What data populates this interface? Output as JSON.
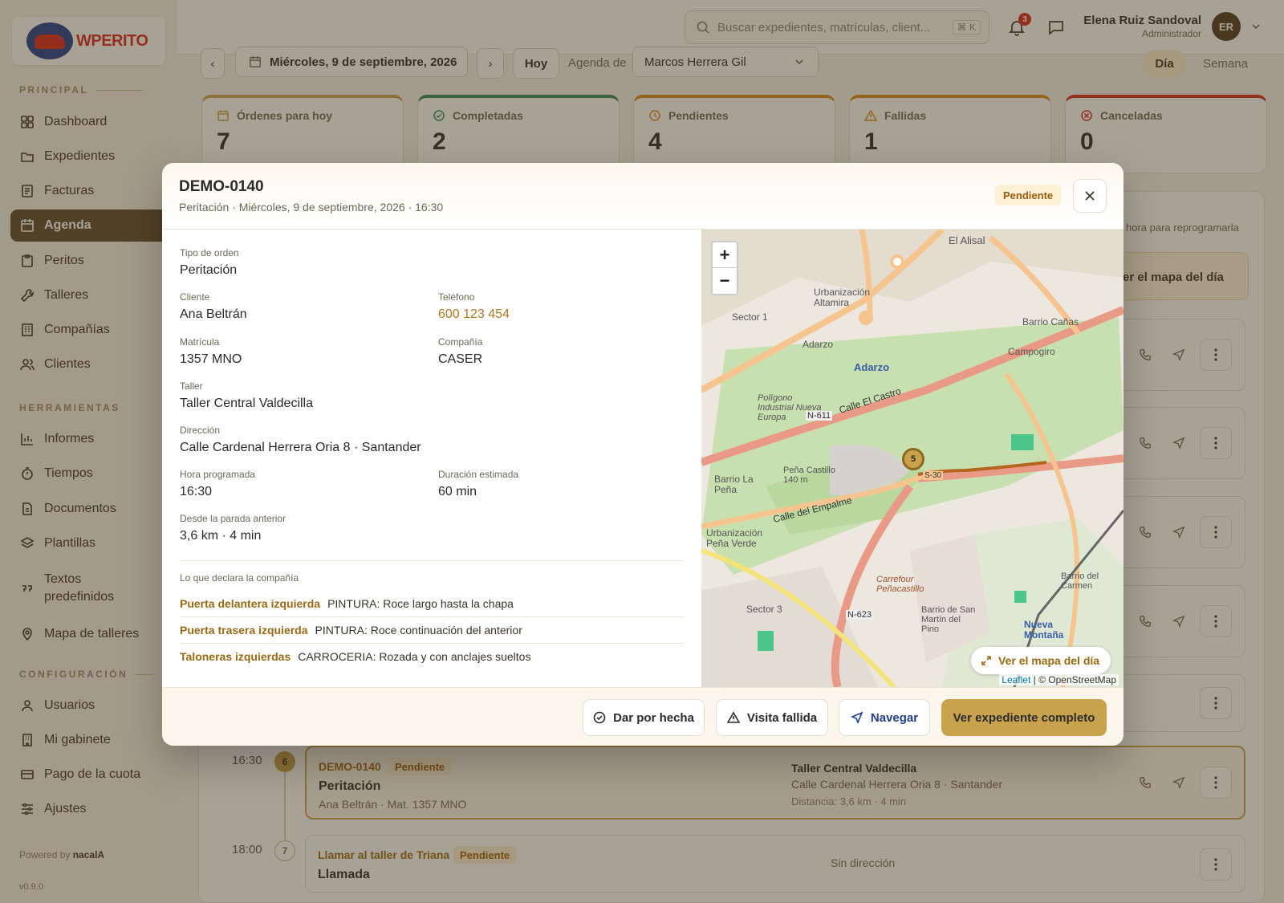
{
  "app": {
    "logo_text": "WPERITO"
  },
  "sidebar": {
    "section_principal": "PRINCIPAL",
    "section_herramientas": "HERRAMIENTAS",
    "section_config": "CONFIGURACIÓN",
    "items": {
      "dashboard": "Dashboard",
      "expedientes": "Expedientes",
      "facturas": "Facturas",
      "agenda": "Agenda",
      "peritos": "Peritos",
      "talleres": "Talleres",
      "companias": "Compañías",
      "clientes": "Clientes",
      "informes": "Informes",
      "tiempos": "Tiempos",
      "documentos": "Documentos",
      "plantillas": "Plantillas",
      "textos_1": "Textos",
      "textos_2": "predefinidos",
      "mapa_talleres": "Mapa de talleres",
      "usuarios": "Usuarios",
      "mi_gabinete": "Mi gabinete",
      "pago_cuota": "Pago de la cuota",
      "ajustes": "Ajustes"
    },
    "powered_prefix": "Powered by",
    "powered_brand": "nacalA",
    "version": "v0.9.0"
  },
  "topbar": {
    "search_placeholder": "Buscar expedientes, matrículas, client...",
    "search_shortcut": "⌘ K",
    "notifications_count": "3",
    "user_name": "Elena Ruiz Sandoval",
    "user_role": "Administrador",
    "avatar_initials": "ER"
  },
  "agenda": {
    "prev": "‹",
    "date": "Miércoles, 9 de septiembre, 2026",
    "next": "›",
    "today": "Hoy",
    "agenda_de_label": "Agenda de",
    "perito": "Marcos Herrera Gil",
    "view_day": "Día",
    "view_week": "Semana",
    "hint": "hora para reprogramarla",
    "map_day_partial": "er el mapa del día"
  },
  "stats": [
    {
      "label": "Órdenes para hoy",
      "value": "7",
      "color": "#c9a24e"
    },
    {
      "label": "Completadas",
      "value": "2",
      "color": "#2e8b57"
    },
    {
      "label": "Pendientes",
      "value": "4",
      "color": "#d98a1c"
    },
    {
      "label": "Fallidas",
      "value": "1",
      "color": "#d98a1c"
    },
    {
      "label": "Canceladas",
      "value": "0",
      "color": "#d9281f"
    }
  ],
  "rows": {
    "r6": {
      "time": "16:30",
      "index": "6",
      "code": "DEMO-0140",
      "status": "Pendiente",
      "type": "Peritación",
      "sub": "Ana Beltrán · Mat. 1357 MNO",
      "workshop": "Taller Central Valdecilla",
      "address": "Calle Cardenal Herrera Oria 8 · Santander",
      "distance": "Distancia: 3,6 km · 4 min"
    },
    "r7": {
      "time": "18:00",
      "index": "7",
      "title": "Llamar al taller de Triana",
      "status": "Pendiente",
      "type": "Llamada",
      "address": "Sin dirección"
    }
  },
  "modal": {
    "title": "DEMO-0140",
    "subtitle": "Peritación · Miércoles, 9 de septiembre, 2026 · 16:30",
    "status": "Pendiente",
    "fields": {
      "tipo_label": "Tipo de orden",
      "tipo_value": "Peritación",
      "cliente_label": "Cliente",
      "cliente_value": "Ana Beltrán",
      "telefono_label": "Teléfono",
      "telefono_value": "600 123 454",
      "matricula_label": "Matrícula",
      "matricula_value": "1357 MNO",
      "compania_label": "Compañía",
      "compania_value": "CASER",
      "taller_label": "Taller",
      "taller_value": "Taller Central Valdecilla",
      "direccion_label": "Dirección",
      "direccion_value": "Calle Cardenal Herrera Oria 8 · Santander",
      "hora_label": "Hora programada",
      "hora_value": "16:30",
      "duracion_label": "Duración estimada",
      "duracion_value": "60 min",
      "desde_label": "Desde la parada anterior",
      "desde_value": "3,6 km · 4 min"
    },
    "declares_title": "Lo que declara la compañía",
    "declares": [
      {
        "part": "Puerta delantera izquierda",
        "desc": "PINTURA: Roce largo hasta la chapa"
      },
      {
        "part": "Puerta trasera izquierda",
        "desc": "PINTURA: Roce continuación del anterior"
      },
      {
        "part": "Taloneras izquierdas",
        "desc": "CARROCERIA: Rozada y con anclajes sueltos"
      }
    ],
    "map": {
      "zoom_in": "+",
      "zoom_out": "−",
      "labels": {
        "el_alisal": "El Alisal",
        "urb_altamira": "Urbanización Altamira",
        "sector1": "Sector 1",
        "adarzo": "Adarzo",
        "adarzo_blue": "Adarzo",
        "barrio_canas": "Barrio Cañas",
        "campogiro": "Campogiro",
        "calle_castro": "Calle El Castro",
        "n611": "N-611",
        "poligono": "Polígono Industrial Nueva Europa",
        "pena_castillo": "Peña Castillo 140 m",
        "barrio_la_pena": "Barrio La Peña",
        "calle_empalme": "Calle del Empalme",
        "urb_pena_verde": "Urbanización Peña Verde",
        "carrefour": "Carrefour Peñacastillo",
        "sector3": "Sector 3",
        "n623": "N-623",
        "barrio_san_martin": "Barrio de San Martín del Pino",
        "nueva_montana": "Nueva Montaña",
        "barrio_carmen": "Barrio del Carmen",
        "s30": "S-30"
      },
      "cluster_count": "5",
      "ver_mapa": "Ver el mapa del día",
      "attr_leaflet": "Leaflet",
      "attr_osm": "| © OpenStreetMap"
    },
    "actions": {
      "done": "Dar por hecha",
      "failed": "Visita fallida",
      "navigate": "Navegar",
      "full": "Ver expediente completo"
    }
  }
}
